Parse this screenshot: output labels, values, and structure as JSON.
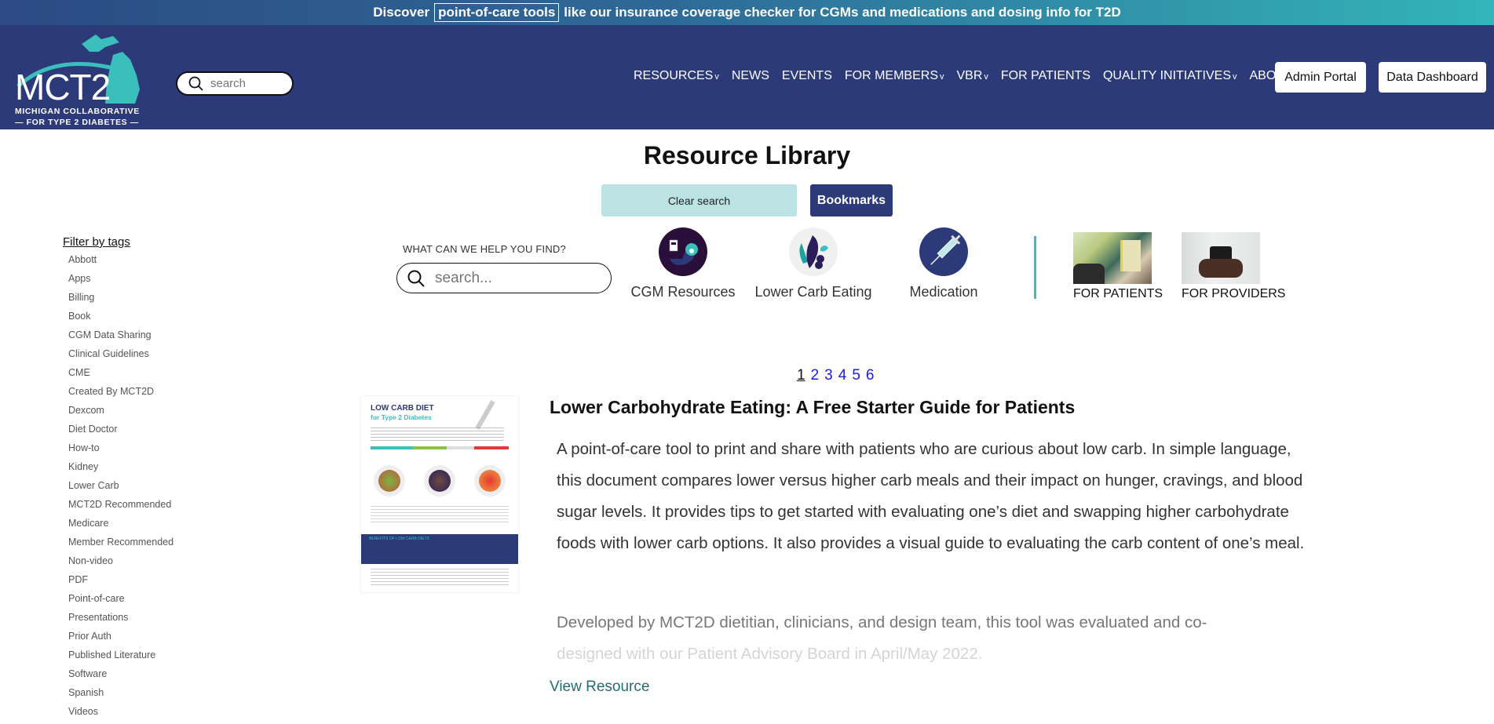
{
  "banner": {
    "prefix": "Discover",
    "highlight": "point-of-care tools",
    "suffix": "like our insurance coverage checker for CGMs and medications and dosing info for T2D"
  },
  "header": {
    "logo": {
      "mark_white": "MCT2",
      "mark_teal": "D",
      "line1": "MICHIGAN COLLABORATIVE",
      "line2": "— FOR TYPE 2 DIABETES —"
    },
    "search_placeholder": "search",
    "nav": [
      {
        "label": "RESOURCES",
        "dropdown": true
      },
      {
        "label": "NEWS",
        "dropdown": false
      },
      {
        "label": "EVENTS",
        "dropdown": false
      },
      {
        "label": "FOR MEMBERS",
        "dropdown": true
      },
      {
        "label": "VBR",
        "dropdown": true
      },
      {
        "label": "FOR PATIENTS",
        "dropdown": false
      },
      {
        "label": "QUALITY INITIATIVES",
        "dropdown": true
      },
      {
        "label": "ABOUT",
        "dropdown": true
      }
    ],
    "chevron": "v",
    "admin_portal": "Admin Portal",
    "data_dashboard": "Data Dashboard"
  },
  "main": {
    "title": "Resource Library",
    "clear_search": "Clear search",
    "bookmarks": "Bookmarks",
    "help_label": "WHAT CAN WE HELP YOU FIND?",
    "search_placeholder": "search...",
    "categories": [
      {
        "label": "CGM Resources",
        "icon": "cgm-arm-icon"
      },
      {
        "label": "Lower Carb Eating",
        "icon": "food-icon"
      },
      {
        "label": "Medication",
        "icon": "syringe-icon"
      }
    ],
    "audiences": [
      {
        "label": "FOR PATIENTS"
      },
      {
        "label": "FOR PROVIDERS"
      }
    ],
    "pagination": {
      "current": 1,
      "pages": [
        "1",
        "2",
        "3",
        "4",
        "5",
        "6"
      ]
    }
  },
  "filter": {
    "title": "Filter by tags",
    "tags": [
      "Abbott",
      "Apps",
      "Billing",
      "Book",
      "CGM Data Sharing",
      "Clinical Guidelines",
      "CME",
      "Created By MCT2D",
      "Dexcom",
      "Diet Doctor",
      "How-to",
      "Kidney",
      "Lower Carb",
      "MCT2D Recommended",
      "Medicare",
      "Member Recommended",
      "Non-video",
      "PDF",
      "Point-of-care",
      "Presentations",
      "Prior Auth",
      "Published Literature",
      "Software",
      "Spanish",
      "Videos"
    ]
  },
  "resource": {
    "title": "Lower Carbohydrate Eating: A Free Starter Guide for Patients",
    "description": "A point-of-care tool to print and share with patients who are curious about low carb. In simple language, this document compares lower versus higher carb meals and their impact on hunger, cravings, and blood sugar levels. It provides tips to get started with evaluating one’s diet and swapping higher carbohydrate foods with lower carb options. It also provides a visual guide to evaluating the carb content of one’s meal.",
    "developed_visible": "Developed by MCT2D dietitian, clinicians, and design team, this tool was evaluated and co-",
    "developed_faded": "designed with our Patient Advisory Board in April/May 2022.",
    "view_link": "View Resource",
    "thumbnail": {
      "title_line1": "LOW CARB DIET",
      "title_line2": "for Type 2 Diabetes",
      "band_label": "BENEFITS OF LOW CARB DIETS"
    }
  },
  "colors": {
    "navy": "#2c3a7a",
    "teal": "#3bbfbd",
    "light_teal": "#bbe3e3",
    "link_blue": "#1a1ae6",
    "view_link": "#256b72"
  }
}
